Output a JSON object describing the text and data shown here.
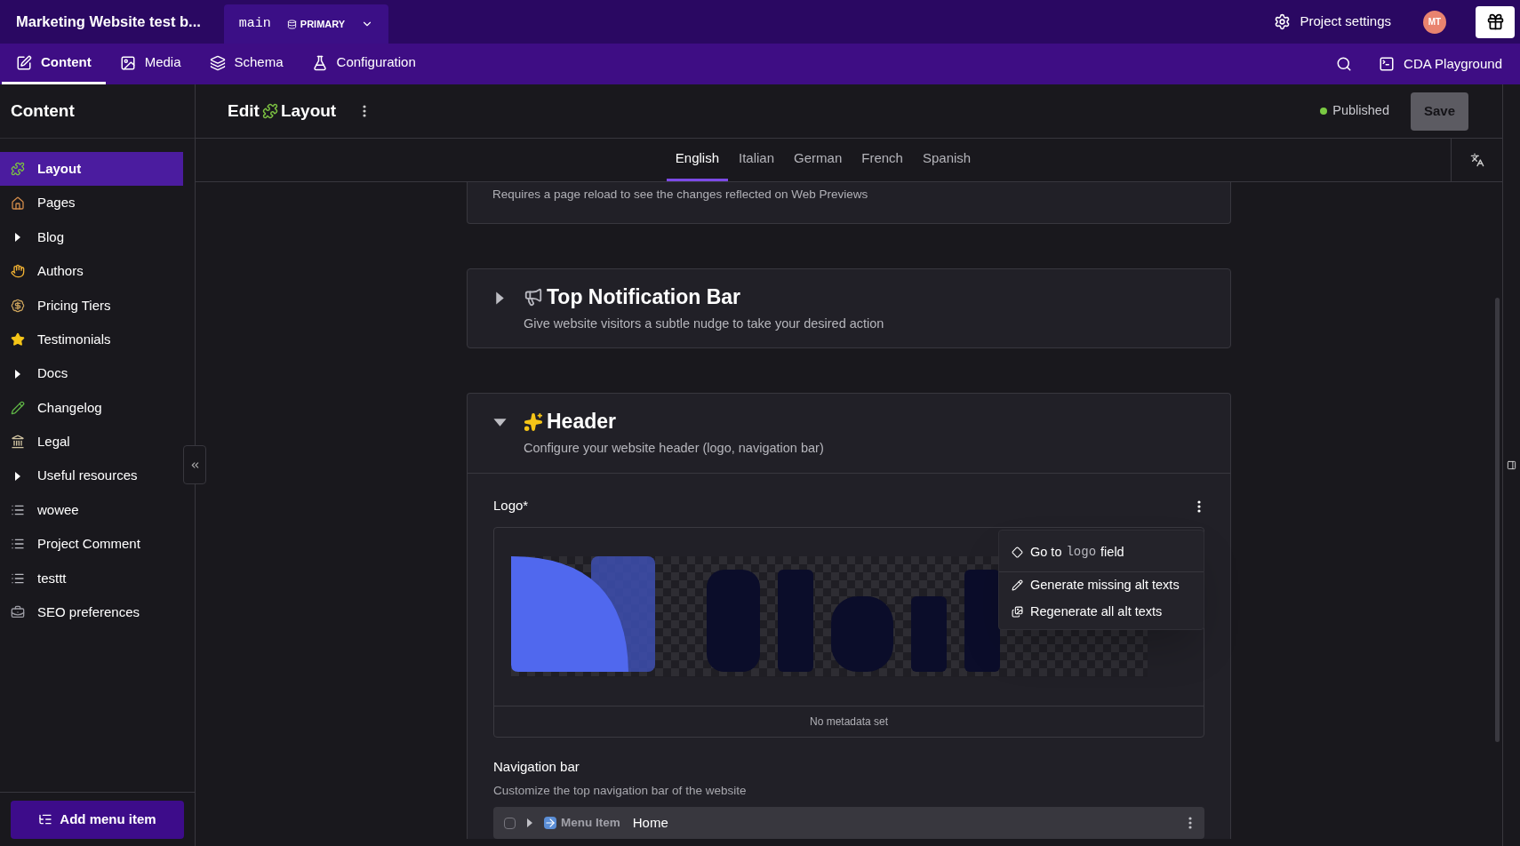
{
  "topbar": {
    "project": "Marketing Website test b...",
    "branch": "main",
    "environment": "PRIMARY",
    "settings": "Project settings",
    "avatar": "MT"
  },
  "nav": {
    "tabs": [
      {
        "label": "Content",
        "selected": true
      },
      {
        "label": "Media",
        "selected": false
      },
      {
        "label": "Schema",
        "selected": false
      },
      {
        "label": "Configuration",
        "selected": false
      }
    ],
    "playground": "CDA Playground"
  },
  "sidebar": {
    "title": "Content",
    "items": [
      {
        "label": "Layout",
        "kind": "entry",
        "selected": true
      },
      {
        "label": "Pages",
        "kind": "entry",
        "selected": false
      },
      {
        "label": "Blog",
        "kind": "folder",
        "selected": false
      },
      {
        "label": "Authors",
        "kind": "entry",
        "selected": false
      },
      {
        "label": "Pricing Tiers",
        "kind": "entry",
        "selected": false
      },
      {
        "label": "Testimonials",
        "kind": "entry",
        "selected": false
      },
      {
        "label": "Docs",
        "kind": "folder",
        "selected": false
      },
      {
        "label": "Changelog",
        "kind": "entry",
        "selected": false
      },
      {
        "label": "Legal",
        "kind": "entry",
        "selected": false
      },
      {
        "label": "Useful resources",
        "kind": "folder",
        "selected": false
      },
      {
        "label": "wowee",
        "kind": "model",
        "selected": false
      },
      {
        "label": "Project Comment",
        "kind": "model",
        "selected": false
      },
      {
        "label": "testtt",
        "kind": "model",
        "selected": false
      },
      {
        "label": "SEO preferences",
        "kind": "entry",
        "selected": false
      }
    ],
    "add_button": "Add menu item"
  },
  "editor": {
    "prefix": "Edit",
    "title": "Layout",
    "status": "Published",
    "save": {
      "label": "Save",
      "disabled": true
    }
  },
  "locales": [
    {
      "label": "English",
      "selected": true
    },
    {
      "label": "Italian",
      "selected": false
    },
    {
      "label": "German",
      "selected": false
    },
    {
      "label": "French",
      "selected": false
    },
    {
      "label": "Spanish",
      "selected": false
    }
  ],
  "notice": "Requires a page reload to see the changes reflected on Web Previews",
  "sections": [
    {
      "title": "Top Notification Bar",
      "description": "Give website visitors a subtle nudge to take your desired action",
      "expanded": false
    },
    {
      "title": "Header",
      "description": "Configure your website header (logo, navigation bar)",
      "expanded": true,
      "logo": {
        "label": "Logo*",
        "metadata": "No metadata set",
        "menu": [
          {
            "kind": "goto",
            "before": "Go to",
            "code": "logo",
            "after": "field"
          },
          {
            "kind": "generate",
            "label": "Generate missing alt texts"
          },
          {
            "kind": "regenerate",
            "label": "Regenerate all alt texts"
          }
        ]
      },
      "navigation": {
        "label": "Navigation bar",
        "hint": "Customize the top navigation bar of the website",
        "rows": [
          {
            "type": "Menu Item",
            "title": "Home",
            "checked": false,
            "expanded": false
          }
        ]
      }
    }
  ]
}
